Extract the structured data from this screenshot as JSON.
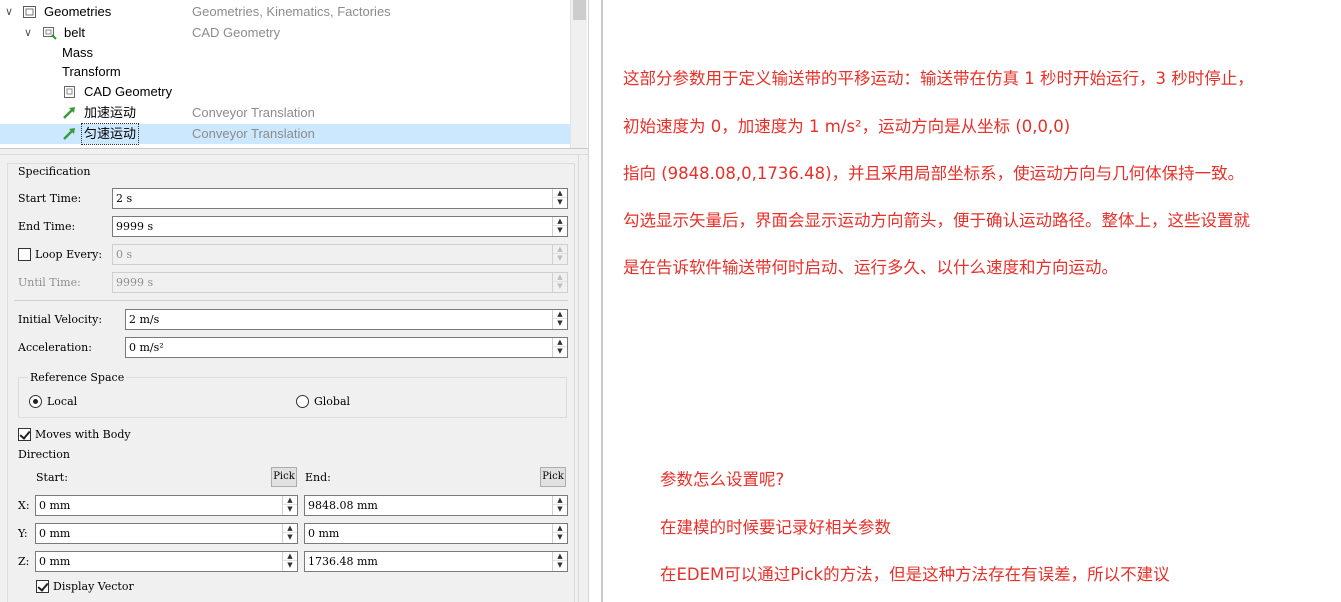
{
  "tree": {
    "rows": [
      {
        "label": "Geometries",
        "desc": "Geometries, Kinematics, Factories",
        "arrow": "∨"
      },
      {
        "label": "belt",
        "desc": "CAD Geometry",
        "arrow": "∨"
      },
      {
        "label": "Mass",
        "desc": ""
      },
      {
        "label": "Transform",
        "desc": ""
      },
      {
        "label": "CAD Geometry",
        "desc": ""
      },
      {
        "label": "加速运动",
        "desc": "Conveyor Translation"
      },
      {
        "label": "匀速运动",
        "desc": "Conveyor Translation"
      }
    ]
  },
  "props": {
    "specification_title": "Specification",
    "start_time": {
      "label": "Start Time:",
      "value": "2 s"
    },
    "end_time": {
      "label": "End Time:",
      "value": "9999 s"
    },
    "loop_every": {
      "label": "Loop Every:",
      "value": "0 s",
      "checked": false
    },
    "until_time": {
      "label": "Until Time:",
      "value": "9999 s"
    },
    "initial_velocity": {
      "label": "Initial Velocity:",
      "value": "2 m/s"
    },
    "acceleration": {
      "label": "Acceleration:",
      "value": "0 m/s²"
    },
    "reference_space": {
      "title": "Reference Space",
      "local": "Local",
      "global": "Global",
      "selected": "local"
    },
    "moves_with_body": {
      "label": "Moves with Body",
      "checked": true
    },
    "direction": {
      "title": "Direction",
      "start_label": "Start:",
      "end_label": "End:",
      "pick_label": "Pick",
      "x_label": "X:",
      "y_label": "Y:",
      "z_label": "Z:",
      "start": {
        "x": "0 mm",
        "y": "0 mm",
        "z": "0 mm"
      },
      "end": {
        "x": "9848.08 mm",
        "y": "0 mm",
        "z": "1736.48 mm"
      }
    },
    "display_vector": {
      "label": "Display Vector",
      "checked": true
    }
  },
  "notes": {
    "lines": [
      "这部分参数用于定义输送带的平移运动：输送带在仿真 1 秒时开始运行，3 秒时停止，",
      "初始速度为 0，加速度为 1 m/s²，运动方向是从坐标 (0,0,0)",
      "指向 (9848.08,0,1736.48)，并且采用局部坐标系，使运动方向与几何体保持一致。",
      "勾选显示矢量后，界面会显示运动方向箭头，便于确认运动路径。整体上，这些设置就",
      "是在告诉软件输送带何时启动、运行多久、以什么速度和方向运动。"
    ],
    "questions": [
      "参数怎么设置呢?",
      "在建模的时候要记录好相关参数",
      "在EDEM可以通过Pick的方法，但是这种方法存在有误差，所以不建议"
    ]
  },
  "colors": {
    "note_text": "#e8302a",
    "selection": "#cce8ff"
  }
}
